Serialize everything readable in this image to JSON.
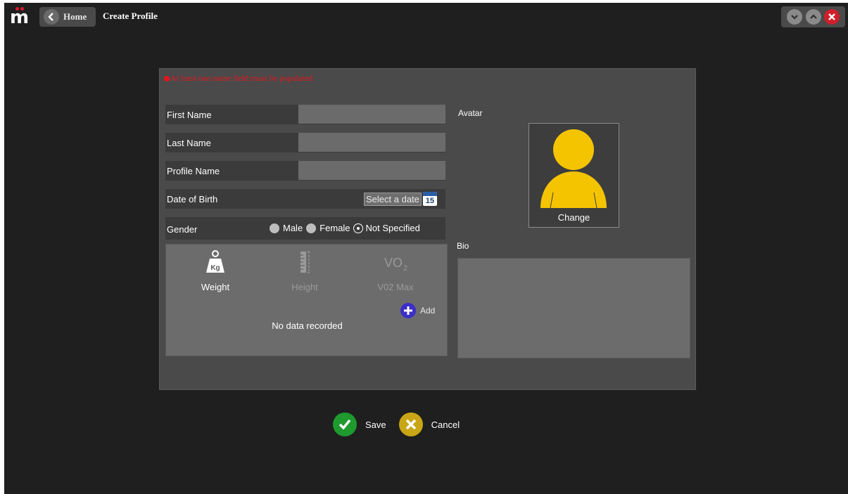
{
  "header": {
    "logo_text": "m",
    "home_label": "Home",
    "page_title": "Create Profile"
  },
  "form": {
    "warning": "At least one name field must be populated",
    "first_name": {
      "label": "First Name",
      "value": ""
    },
    "last_name": {
      "label": "Last Name",
      "value": ""
    },
    "profile_name": {
      "label": "Profile Name",
      "value": ""
    },
    "dob": {
      "label": "Date of Birth",
      "placeholder": "Select a date",
      "calendar_day": "15"
    },
    "gender": {
      "label": "Gender",
      "options": [
        "Male",
        "Female",
        "Not Specified"
      ],
      "selected": "Not Specified"
    }
  },
  "metrics": {
    "tabs": [
      {
        "label": "Weight",
        "icon": "weight-kg-icon",
        "icon_text": "Kg",
        "active": true
      },
      {
        "label": "Height",
        "icon": "ruler-icon",
        "active": false
      },
      {
        "label": "V02 Max",
        "icon": "vo2-icon",
        "icon_text": "VO",
        "icon_sub": "2",
        "active": false
      }
    ],
    "add_label": "Add",
    "empty_text": "No data recorded"
  },
  "avatar": {
    "label": "Avatar",
    "change_label": "Change",
    "color": "#f5c400"
  },
  "bio": {
    "label": "Bio",
    "value": ""
  },
  "actions": {
    "save_label": "Save",
    "cancel_label": "Cancel"
  },
  "colors": {
    "accent_red": "#e5151b",
    "save_green": "#1e9a2e",
    "cancel_yellow": "#c9a615",
    "add_blue": "#3b2ec9"
  }
}
